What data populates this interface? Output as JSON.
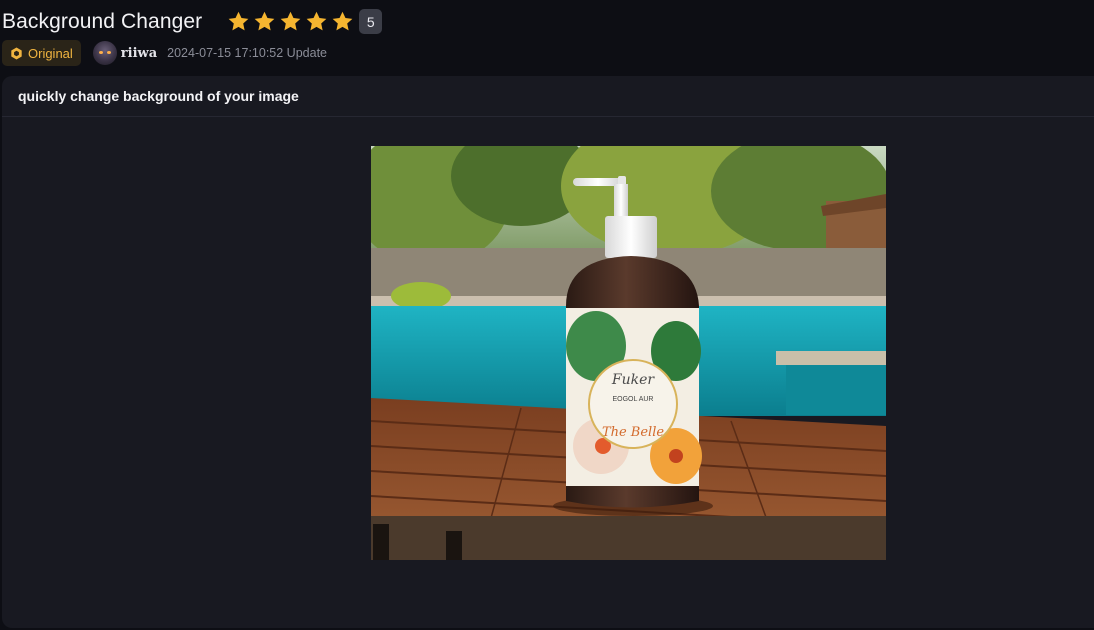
{
  "header": {
    "title": "Background Changer",
    "rating": {
      "stars": 5,
      "value": "5"
    },
    "origin_badge": "Original",
    "author": "riiwa",
    "updated": "2024-07-15 17:10:52 Update"
  },
  "card": {
    "description": "quickly change background of your image"
  },
  "colors": {
    "star": "#f5b530",
    "origin": "#f0b440",
    "background": "#0d0e14",
    "card": "#181921"
  },
  "icons": {
    "star": "star-icon",
    "origin": "hexagon-badge-icon"
  }
}
